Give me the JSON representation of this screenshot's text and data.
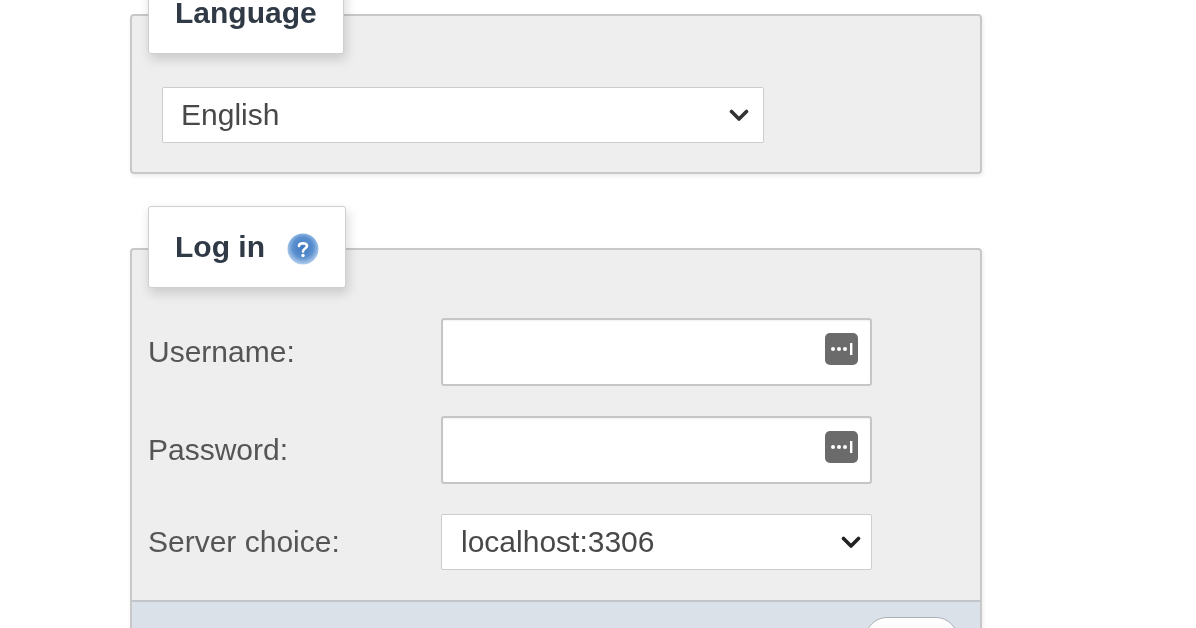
{
  "language": {
    "legend": "Language",
    "select": {
      "value": "English"
    }
  },
  "login": {
    "legend": "Log in",
    "fields": [
      {
        "label": "Username:",
        "kind": "input"
      },
      {
        "label": "Password:",
        "kind": "input"
      },
      {
        "label": "Server choice:",
        "kind": "select",
        "value": "localhost:3306"
      }
    ]
  }
}
